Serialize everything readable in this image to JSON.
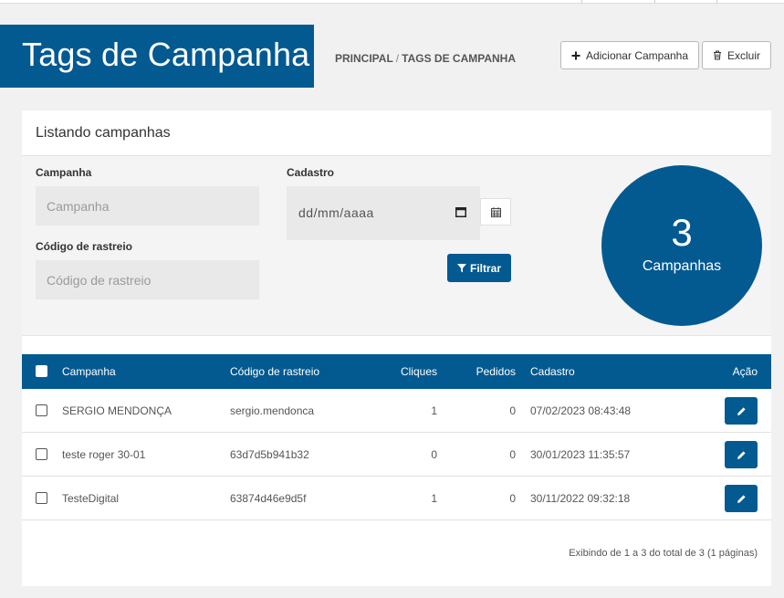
{
  "header": {
    "title": "Tags de Campanha",
    "breadcrumb": {
      "home": "PRINCIPAL",
      "separator": "/",
      "current": "TAGS DE CAMPANHA"
    },
    "add_button": "Adicionar Campanha",
    "delete_button": "Excluir"
  },
  "panel": {
    "title": "Listando campanhas",
    "filters": {
      "campanha_label": "Campanha",
      "campanha_placeholder": "Campanha",
      "codigo_label": "Código de rastreio",
      "codigo_placeholder": "Código de rastreio",
      "cadastro_label": "Cadastro",
      "cadastro_placeholder": "dd/mm/aaaa",
      "filter_button": "Filtrar"
    },
    "summary": {
      "count": "3",
      "label": "Campanhas"
    }
  },
  "table": {
    "columns": {
      "campanha": "Campanha",
      "codigo": "Código de rastreio",
      "cliques": "Cliques",
      "pedidos": "Pedidos",
      "cadastro": "Cadastro",
      "acao": "Ação"
    },
    "rows": [
      {
        "campanha": "SERGIO MENDONÇA",
        "codigo": "sergio.mendonca",
        "cliques": "1",
        "pedidos": "0",
        "cadastro": "07/02/2023 08:43:48"
      },
      {
        "campanha": "teste roger 30-01",
        "codigo": "63d7d5b941b32",
        "cliques": "0",
        "pedidos": "0",
        "cadastro": "30/01/2023 11:35:57"
      },
      {
        "campanha": "TesteDigital",
        "codigo": "63874d46e9d5f",
        "cliques": "1",
        "pedidos": "0",
        "cadastro": "30/11/2022 09:32:18"
      }
    ],
    "footer": "Exibindo de 1 a 3 do total de 3 (1 páginas)"
  },
  "colors": {
    "primary": "#035a91",
    "background": "#f1f1f1"
  }
}
